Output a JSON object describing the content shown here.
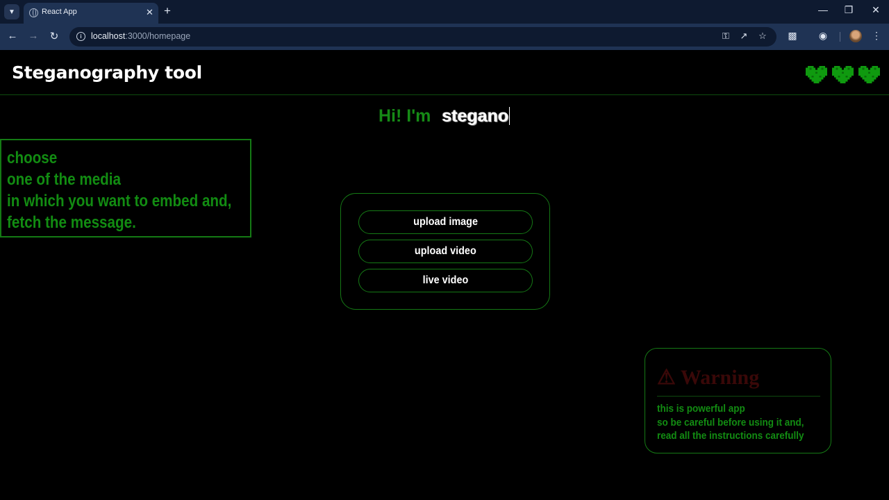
{
  "browser": {
    "tab_title": "React App",
    "url_host": "localhost",
    "url_path": ":3000/homepage"
  },
  "app": {
    "title": "Steganography tool",
    "lives": 3,
    "accent_color": "#128c12"
  },
  "greeting": {
    "prefix": "Hi! I'm",
    "name": "stegano"
  },
  "instructions": {
    "lines": [
      "choose",
      "one of the media",
      "in which you want to embed and,",
      "fetch the message."
    ]
  },
  "media_options": [
    {
      "label": "upload image"
    },
    {
      "label": "upload video"
    },
    {
      "label": "live video"
    }
  ],
  "warning": {
    "title": "⚠ Warning",
    "lines": [
      "this is powerful app",
      "so be careful before using it and,",
      "read all the instructions carefully"
    ]
  }
}
